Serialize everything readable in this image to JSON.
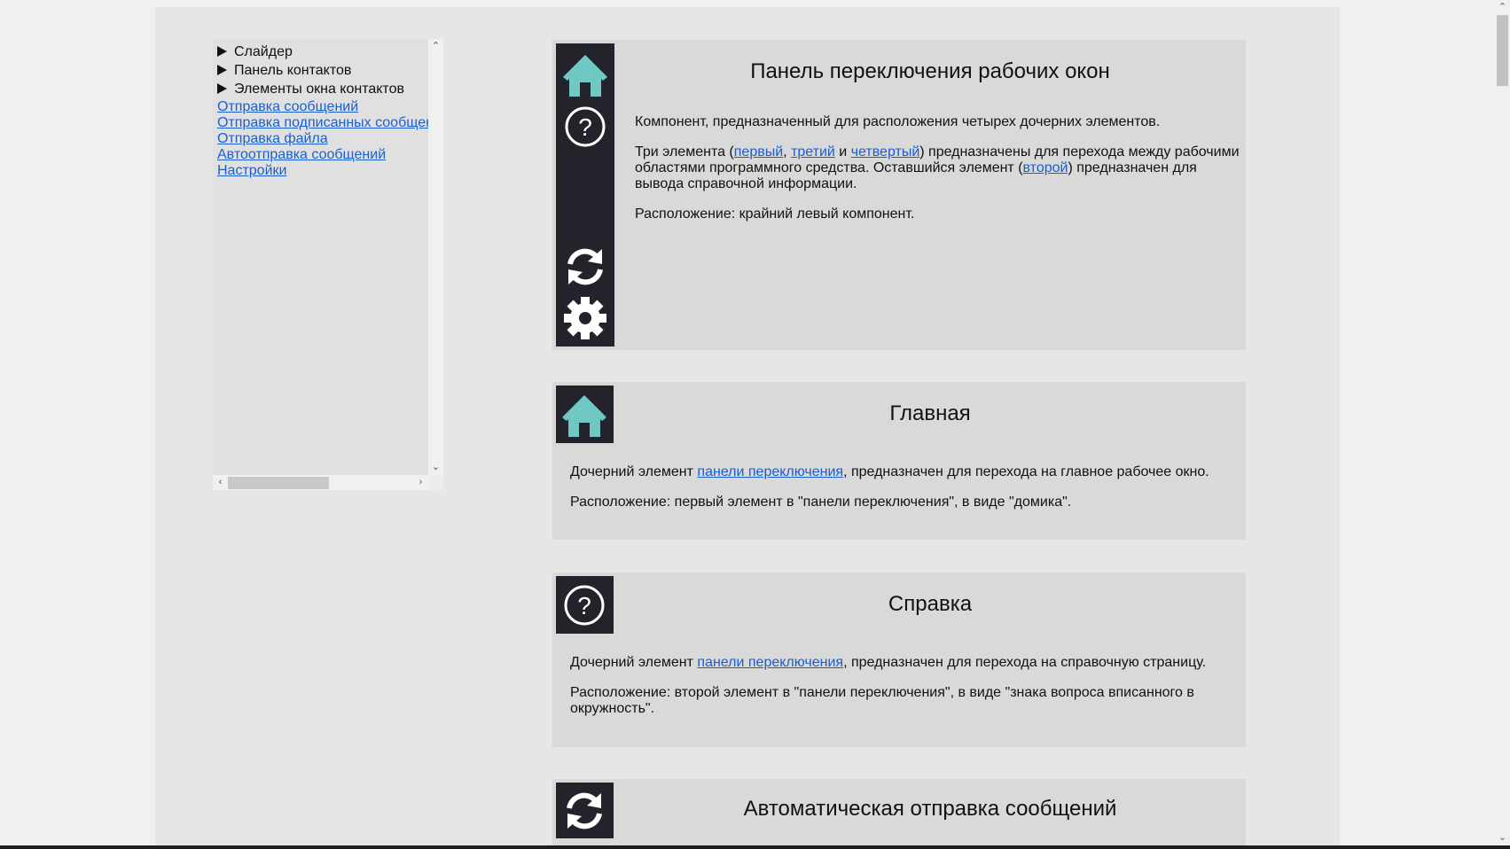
{
  "sidebar": {
    "tree_nodes": [
      {
        "label": "Слайдер"
      },
      {
        "label": "Панель контактов"
      },
      {
        "label": "Элементы окна контактов"
      }
    ],
    "links": [
      {
        "label": "Отправка сообщений"
      },
      {
        "label": "Отправка подписанных сообщений"
      },
      {
        "label": "Отправка файла"
      },
      {
        "label": "Автоотправка сообщений"
      },
      {
        "label": "Настройки"
      }
    ]
  },
  "cards": {
    "switch_panel": {
      "title": "Панель переключения рабочих окон",
      "intro": "Компонент, предназначенный для расположения четырех дочерних элементов.",
      "p2_start": "Три элемента (",
      "link_first": "первый",
      "sep1": ", ",
      "link_third": "третий",
      "sep2": " и ",
      "link_fourth": "четвертый",
      "p2_mid": ") предназначены для перехода между рабочими областями программного средства. Оставшийся элемент (",
      "link_second": "второй",
      "p2_end": ") предназначен для вывода справочной информации.",
      "location": "Расположение: крайний левый компонент.",
      "icons": [
        "home-icon",
        "help-icon",
        "refresh-icon",
        "gear-icon"
      ]
    },
    "home": {
      "title": "Главная",
      "p1_start": "Дочерний элемент ",
      "p1_link": "панели переключения",
      "p1_end": ", предназначен для перехода на главное рабочее окно.",
      "location": "Расположение: первый элемент в \"панели переключения\", в виде \"домика\".",
      "icon": "home-icon"
    },
    "help": {
      "title": "Справка",
      "p1_start": "Дочерний элемент ",
      "p1_link": "панели переключения",
      "p1_end": ", предназначен для перехода на справочную страницу.",
      "location": "Расположение: второй элемент в \"панели переключения\", в виде \"знака вопроса вписанного в окружность\".",
      "icon": "help-icon"
    },
    "autosend": {
      "title": "Автоматическая отправка сообщений",
      "icon": "refresh-icon"
    }
  },
  "colors": {
    "icon_bg": "#23232b",
    "home_icon": "#6fc8c4",
    "link": "#1a5fd0",
    "card_bg": "#d9d9d9",
    "page_bg": "#e6e6e6"
  }
}
